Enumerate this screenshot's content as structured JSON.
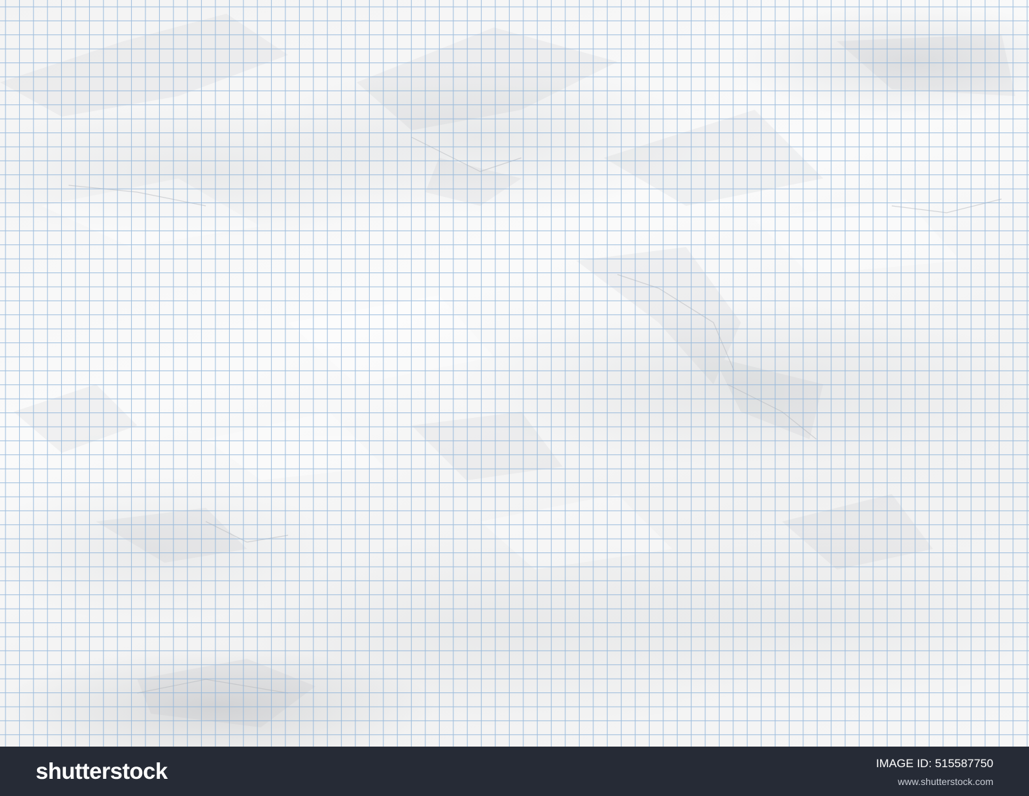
{
  "paper": {
    "grid_color": "#8fb4d9",
    "paper_color": "#f6f6f6"
  },
  "footer": {
    "background_color": "#262b36",
    "logo_text": "shutterstock",
    "image_id_label": "IMAGE ID:",
    "image_id_value": "515587750",
    "site_url": "www.shutterstock.com"
  }
}
